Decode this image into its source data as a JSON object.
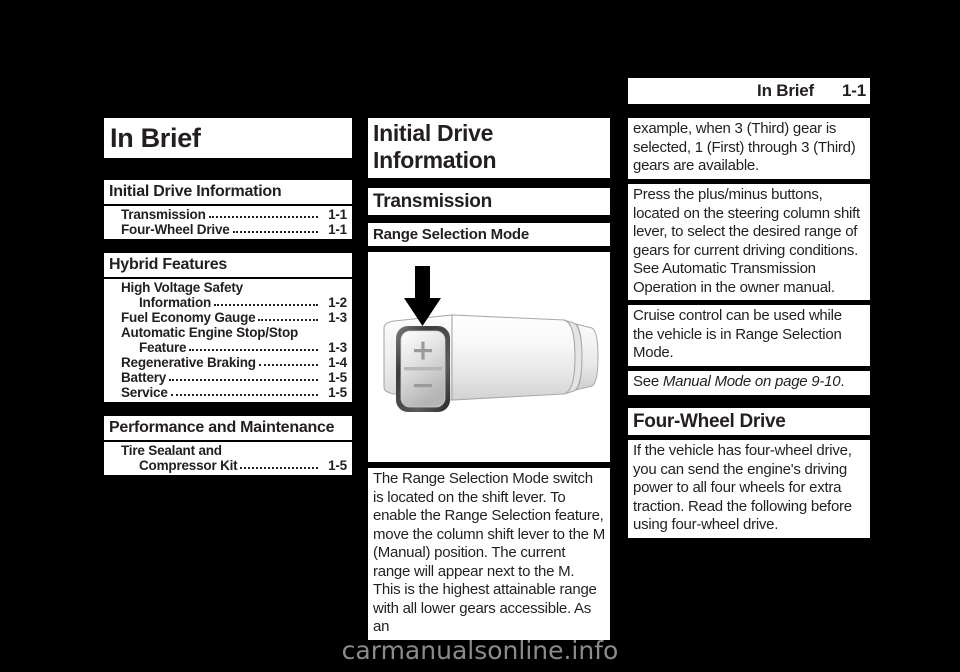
{
  "header": {
    "title": "In Brief",
    "page_number": "1-1"
  },
  "left_column": {
    "chapter_title": "In Brief",
    "toc_sections": [
      {
        "heading": "Initial Drive Information",
        "entries": [
          {
            "label": "Transmission",
            "page": "1-1",
            "indent": 1
          },
          {
            "label": "Four-Wheel Drive",
            "page": "1-1",
            "indent": 1
          }
        ]
      },
      {
        "heading": "Hybrid Features",
        "entries": [
          {
            "label": "High Voltage Safety",
            "page": "",
            "indent": 1
          },
          {
            "label": "Information",
            "page": "1-2",
            "indent": 2
          },
          {
            "label": "Fuel Economy Gauge",
            "page": "1-3",
            "indent": 1
          },
          {
            "label": "Automatic Engine Stop/Stop",
            "page": "",
            "indent": 1
          },
          {
            "label": "Feature",
            "page": "1-3",
            "indent": 2
          },
          {
            "label": "Regenerative Braking",
            "page": "1-4",
            "indent": 1
          },
          {
            "label": "Battery",
            "page": "1-5",
            "indent": 1
          },
          {
            "label": "Service",
            "page": "1-5",
            "indent": 1
          }
        ]
      },
      {
        "heading": "Performance and Maintenance",
        "entries": [
          {
            "label": "Tire Sealant and",
            "page": "",
            "indent": 1
          },
          {
            "label": "Compressor Kit",
            "page": "1-5",
            "indent": 2
          }
        ]
      }
    ]
  },
  "middle_column": {
    "section_title": "Initial Drive Information",
    "subsection_title": "Transmission",
    "sub_subsection_title": "Range Selection Mode",
    "figure": {
      "alt": "Shift lever knob with plus and minus range selection rocker switch, black arrow pointing to switch",
      "plus_label": "+",
      "minus_label": "−"
    },
    "body_paragraph": "The Range Selection Mode switch is located on the shift lever. To enable the Range Selection feature, move the column shift lever to the M (Manual) position. The current range will appear next to the M. This is the highest attainable range with all lower gears accessible. As an"
  },
  "right_column": {
    "paragraph_1": "example, when 3 (Third) gear is selected, 1 (First) through 3 (Third) gears are available.",
    "paragraph_2": "Press the plus/minus buttons, located on the steering column shift lever, to select the desired range of gears for current driving conditions. See Automatic Transmission Operation in the owner manual.",
    "paragraph_3": "Cruise control can be used while the vehicle is in Range Selection Mode.",
    "cross_reference": {
      "prefix": "See ",
      "italic": "Manual Mode on page 9-10",
      "suffix": "."
    },
    "section_title": "Four-Wheel Drive",
    "paragraph_4": "If the vehicle has four-wheel drive, you can send the engine's driving power to all four wheels for extra traction. Read the following before using four-wheel drive."
  },
  "watermark": "carmanualsonline.info",
  "colors": {
    "page_background": "#000000",
    "block_background": "#ffffff",
    "text": "#231f20",
    "watermark": "#8b8b8b"
  }
}
